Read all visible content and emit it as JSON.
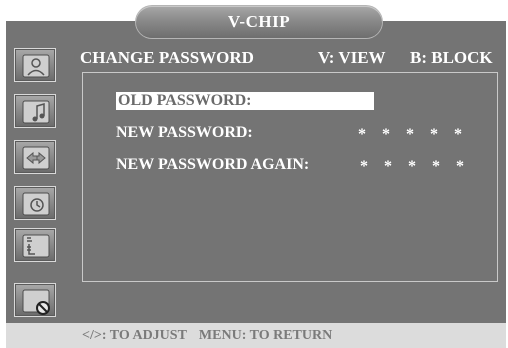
{
  "header": {
    "title": "V-CHIP"
  },
  "sidebar": {
    "items": [
      {
        "icon": "picture-icon"
      },
      {
        "icon": "audio-icon"
      },
      {
        "icon": "input-source-icon"
      },
      {
        "icon": "timer-icon"
      },
      {
        "icon": "setup-icon"
      },
      {
        "icon": "lock-icon"
      }
    ]
  },
  "menu": {
    "heading": "CHANGE PASSWORD",
    "view_hint": "V: VIEW",
    "block_hint": "B: BLOCK",
    "fields": [
      {
        "label": "OLD PASSWORD:",
        "value": "",
        "selected": true
      },
      {
        "label": "NEW PASSWORD:",
        "value": "* * * * *",
        "selected": false
      },
      {
        "label": "NEW PASSWORD AGAIN:",
        "value": "* * * * *",
        "selected": false
      }
    ]
  },
  "footer": {
    "adjust_hint": "</>: TO ADJUST",
    "return_hint": "MENU: TO RETURN"
  },
  "colors": {
    "panel": "#747474",
    "footer": "#dcdcdc",
    "text": "#ffffff",
    "selection": "#ffffff"
  }
}
